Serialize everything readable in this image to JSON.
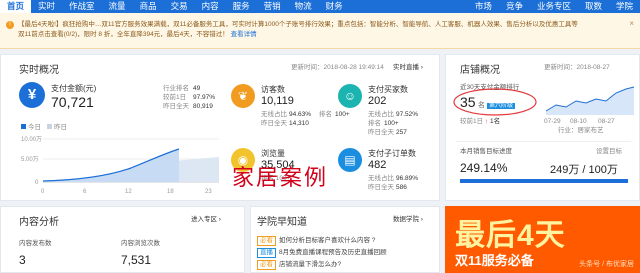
{
  "nav": {
    "items": [
      "首页",
      "实时",
      "作战室",
      "流量",
      "商品",
      "交易",
      "内容",
      "服务",
      "营销",
      "物流",
      "财务",
      "市场",
      "竞争",
      "业务专区",
      "取数",
      "学院"
    ],
    "active_index": 0
  },
  "notice": {
    "line1": "【最后4天啦!】疯狂抢购中…双11官方服务效果满载，双11必备服务工具，可实时计算1000个子账号排行效果；重点包括：智能分析、智能导航、人工客服、机器人效果、售后分析以及优惠工具等",
    "line2": "双11前点击查看(0/2)，限时 8 折，全年直降394元，最后4天，不容错过！",
    "link": "查看详情",
    "close": "×"
  },
  "realtime": {
    "title": "实时概况",
    "updated": "更新时间：2018-08-28 19:49:14",
    "link": "实时直播 ›",
    "pay": {
      "label": "支付金额(元)",
      "value": "70,721",
      "rank_label": "行业排名",
      "rank": "49",
      "pct_label": "较前1日",
      "pct": "97.97%",
      "yesterday_label": "昨日全天",
      "yesterday": "80,919"
    },
    "legend_today": "今日",
    "legend_yesterday": "昨日",
    "y_labels": [
      "10.00万",
      "5.00万",
      "0"
    ],
    "x_labels": [
      "0",
      "6",
      "12",
      "18",
      "23"
    ],
    "visitors": {
      "label": "访客数",
      "value": "10,119",
      "r1l": "无线占比",
      "r1": "94.63%",
      "r1b": "排名",
      "r1v": "100+",
      "r2l": "昨日全天",
      "r2": "14,310"
    },
    "buyers": {
      "label": "支付买家数",
      "value": "202",
      "r1l": "无线占比",
      "r1": "97.52%",
      "r1b": "排名",
      "r1v": "100+",
      "r2l": "昨日全天",
      "r2": "257"
    },
    "pv": {
      "label": "浏览量",
      "value": "35,504",
      "r1": "排名 100+"
    },
    "orders": {
      "label": "支付子订单数",
      "value": "482",
      "r1l": "无线占比",
      "r1": "96.89%",
      "r2l": "昨日全天",
      "r2": "586"
    }
  },
  "shop": {
    "title": "店铺概况",
    "updated": "更新时间：2018-08-27",
    "rank_caption": "近30天支付金额排行",
    "rank_value": "35",
    "rank_unit": "名",
    "rank_tier": "第六阶级",
    "compare_label": "较前1日",
    "compare_value": "1名",
    "dates": [
      "07-29",
      "08-10",
      "08-27"
    ],
    "industry": "行业：居家布艺",
    "goal_label": "本月销售目标进度",
    "goal_link": "设置目标",
    "goal_pct": "249.14%",
    "goal_amount": "249万 / 100万",
    "goal_pct_value": 249.14
  },
  "content": {
    "title": "内容分析",
    "link": "进入专区 ›",
    "pub_label": "内容发布数",
    "pub_value": "3",
    "view_label": "内容浏览次数",
    "view_value": "7,531"
  },
  "learn": {
    "title": "学院早知道",
    "link": "数据学院 ›",
    "items": [
      {
        "tag": "必看",
        "text": "如何分析目标客户喜欢什么内容 ?"
      },
      {
        "tag": "直播",
        "text": "8月免费直播课程预告及历史直播回顾"
      },
      {
        "tag": "必看",
        "text": "店铺流量下滑怎么办?"
      }
    ]
  },
  "ad": {
    "headline": "最后4天",
    "sub": "双11服务必备",
    "credit": "头条号 / 布优家居"
  },
  "watermark": "家居案例",
  "colors": {
    "nav": "#1b6fd6",
    "pay_circle": "#1b6fd6",
    "visitor_circle": "#f29b21",
    "buyer_circle": "#1bb4b0",
    "pv_circle": "#f2c32c",
    "order_circle": "#1b8ee0",
    "ad": "#ff5a00"
  }
}
